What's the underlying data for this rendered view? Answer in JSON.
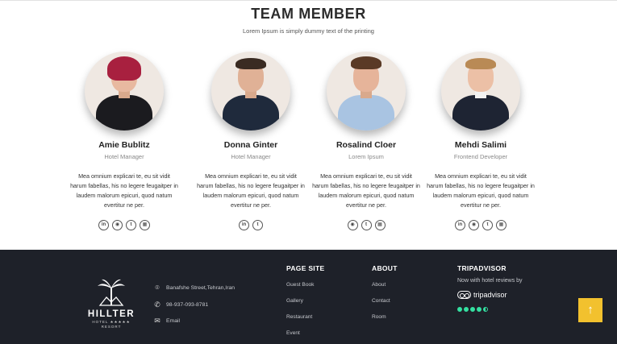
{
  "team": {
    "title": "TEAM MEMBER",
    "subtitle": "Lorem Ipsum is simply dummy text of the printing",
    "members": [
      {
        "name": "Amie Bublitz",
        "role": "Hotel Manager",
        "bio": "Mea omnium explicari te, eu sit vidit harum fabellas, his no legere feugaitper in laudem malorum epicuri, quod natum evertitur ne per.",
        "socials": [
          "linkedin-icon",
          "github-icon",
          "twitter-icon",
          "website-icon"
        ]
      },
      {
        "name": "Donna Ginter",
        "role": "Hotel Manager",
        "bio": "Mea omnium explicari te, eu sit vidit harum fabellas, his no legere feugaitper in laudem malorum epicuri, quod natum evertitur ne per.",
        "socials": [
          "linkedin-icon",
          "twitter-icon"
        ]
      },
      {
        "name": "Rosalind Cloer",
        "role": "Lorem Ipsum",
        "bio": "Mea omnium explicari te, eu sit vidit harum fabellas, his no legere feugaitper in laudem malorum epicuri, quod natum evertitur ne per.",
        "socials": [
          "github-icon",
          "twitter-icon",
          "website-icon"
        ]
      },
      {
        "name": "Mehdi Salimi",
        "role": "Frontend Developer",
        "bio": "Mea omnium explicari te, eu sit vidit harum fabellas, his no legere feugaitper in laudem malorum epicuri, quod natum evertitur ne per.",
        "socials": [
          "linkedin-icon",
          "github-icon",
          "twitter-icon",
          "website-icon"
        ]
      }
    ]
  },
  "footer": {
    "logo": {
      "name": "HILLTER",
      "tagline": "HOTEL ★★★★★ RESORT"
    },
    "contact": {
      "address": "Banafshe Street,Tehran,Iran",
      "phone": "98-937-093-8781",
      "email": "Email"
    },
    "page_site": {
      "title": "PAGE SITE",
      "links": [
        "Guest Book",
        "Gallery",
        "Restaurant",
        "Event"
      ]
    },
    "about": {
      "title": "ABOUT",
      "links": [
        "About",
        "Contact",
        "Room"
      ]
    },
    "tripadvisor": {
      "title": "TRIPADVISOR",
      "text": "Now with hotel reviews by",
      "brand": "tripadvisor",
      "rating": 4.5
    },
    "back_to_top": "↑"
  },
  "colors": {
    "footer_bg": "#1e2129",
    "accent_yellow": "#f2c12e",
    "tripadvisor_green": "#34e0a1"
  }
}
